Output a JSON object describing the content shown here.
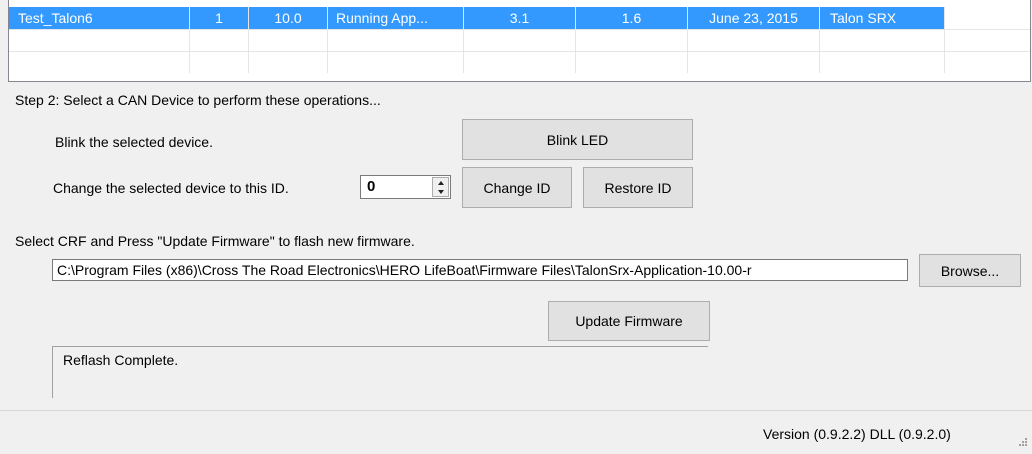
{
  "device_list": {
    "rows": [
      [
        "Test_Talon6",
        "1",
        "10.0",
        "Running App...",
        "3.1",
        "1.6",
        "June 23, 2015",
        "Talon SRX",
        ""
      ],
      [
        "",
        "",
        "",
        "",
        "",
        "",
        "",
        "",
        ""
      ],
      [
        "",
        "",
        "",
        "",
        "",
        "",
        "",
        "",
        ""
      ]
    ]
  },
  "step2": {
    "heading": "Step 2: Select a CAN Device to perform these operations...",
    "blink_label": "Blink the selected device.",
    "blink_button": "Blink LED",
    "change_label": "Change the selected device to this ID.",
    "id_value": "0",
    "change_button": "Change ID",
    "restore_button": "Restore ID"
  },
  "firmware": {
    "instruction": "Select CRF and Press \"Update Firmware\" to flash new firmware.",
    "path": "C:\\Program Files (x86)\\Cross The Road Electronics\\HERO LifeBoat\\Firmware Files\\TalonSrx-Application-10.00-r",
    "browse_button": "Browse...",
    "update_button": "Update Firmware",
    "status_text": "Reflash Complete."
  },
  "statusbar": {
    "version_text": "Version (0.9.2.2)  DLL (0.9.2.0)"
  },
  "colors": {
    "selection": "#3399ff",
    "window_bg": "#f0f0f0",
    "button_bg": "#e1e1e1"
  }
}
